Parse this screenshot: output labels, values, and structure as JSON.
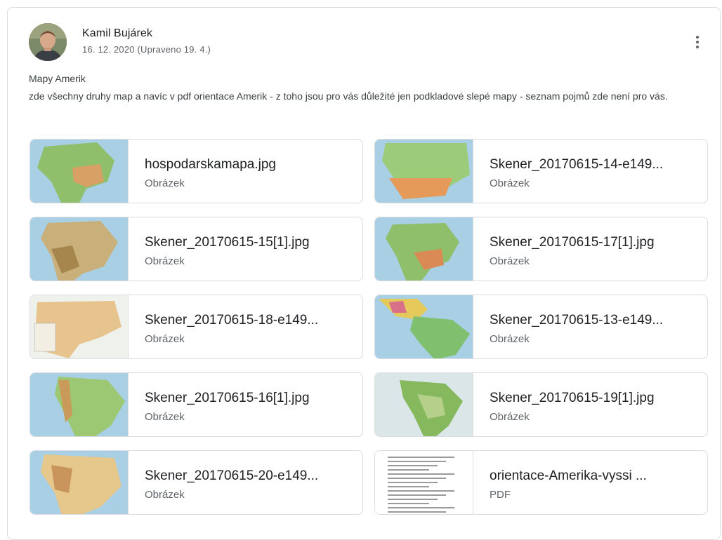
{
  "post": {
    "author": "Kamil Bujárek",
    "date": "16. 12. 2020 (Upraveno 19. 4.)",
    "title": "Mapy Amerik",
    "body": "zde všechny druhy map a navíc v pdf orientace Amerik - z toho jsou pro vás důležité jen podkladové slepé mapy - seznam pojmů zde není pro vás.",
    "more_icon": "more-vert-icon"
  },
  "attachments": [
    {
      "name": "hospodarskamapa.jpg",
      "type": "Obrázek"
    },
    {
      "name": "Skener_20170615-14-e149...",
      "type": "Obrázek"
    },
    {
      "name": "Skener_20170615-15[1].jpg",
      "type": "Obrázek"
    },
    {
      "name": "Skener_20170615-17[1].jpg",
      "type": "Obrázek"
    },
    {
      "name": "Skener_20170615-18-e149...",
      "type": "Obrázek"
    },
    {
      "name": "Skener_20170615-13-e149...",
      "type": "Obrázek"
    },
    {
      "name": "Skener_20170615-16[1].jpg",
      "type": "Obrázek"
    },
    {
      "name": "Skener_20170615-19[1].jpg",
      "type": "Obrázek"
    },
    {
      "name": "Skener_20170615-20-e149...",
      "type": "Obrázek"
    },
    {
      "name": "orientace-Amerika-vyssi ...",
      "type": "PDF"
    }
  ],
  "colors": {
    "border": "#dadce0",
    "text_primary": "#202124",
    "text_secondary": "#5f6368",
    "water": "#a9cfe4",
    "land_green": "#8fbf6a",
    "land_orange": "#d9a066"
  }
}
